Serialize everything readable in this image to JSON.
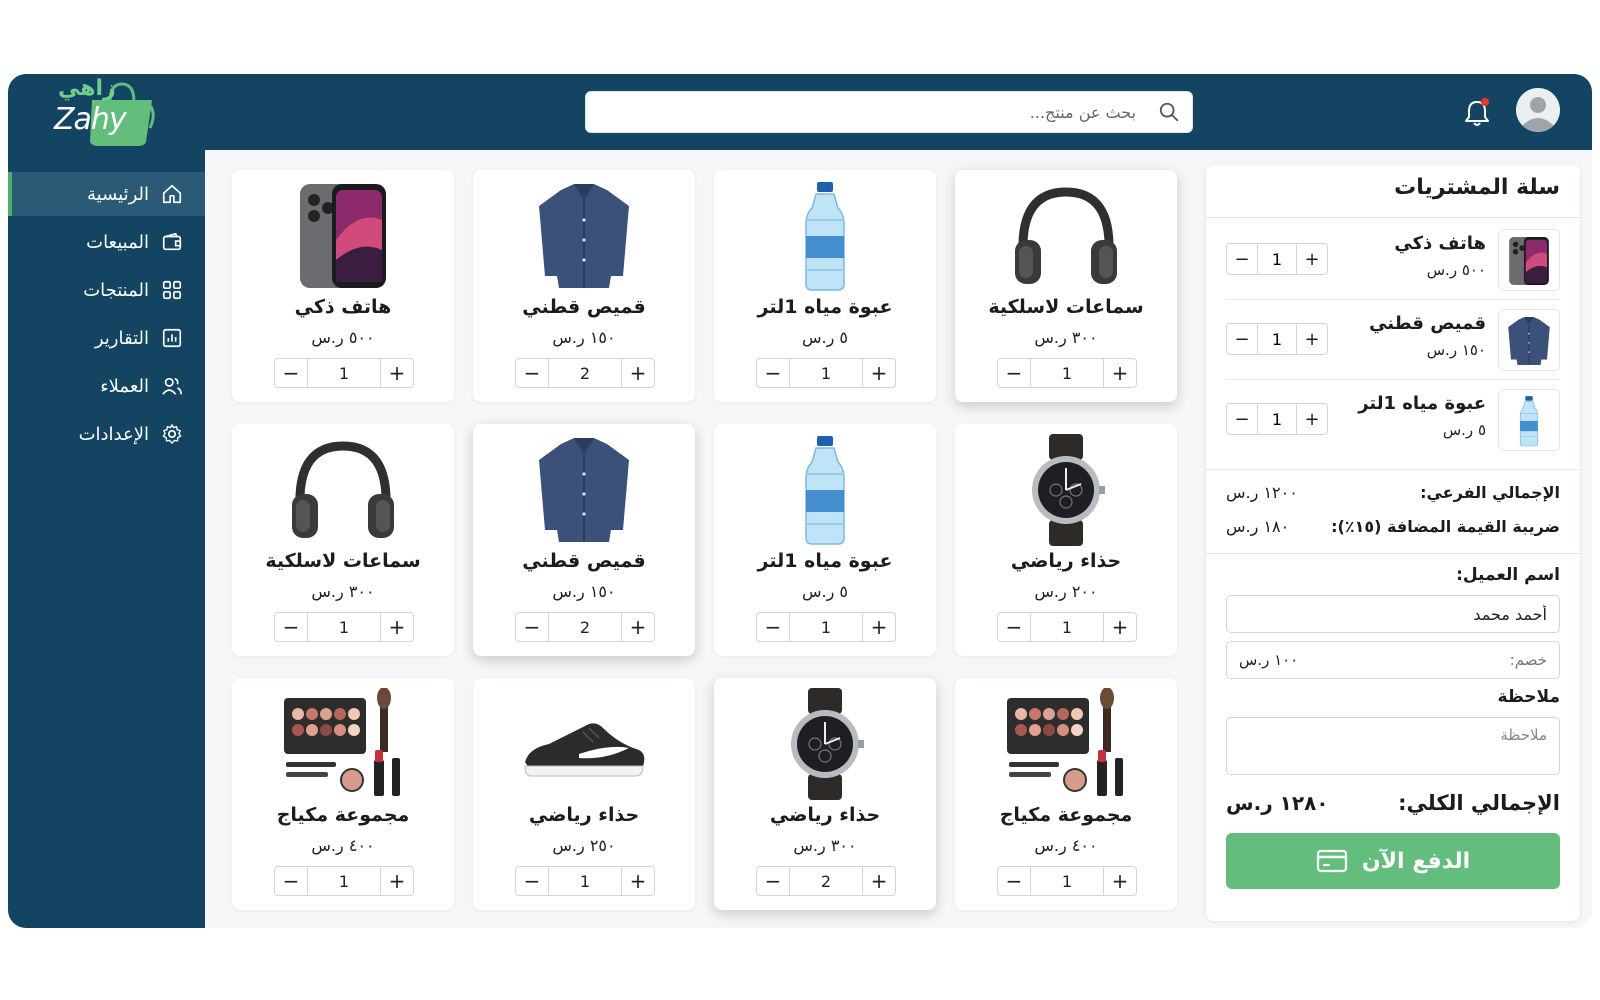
{
  "brand": {
    "logo_latin": "Zahy",
    "logo_arabic": "زاهي"
  },
  "search": {
    "placeholder": "بحث عن منتج..."
  },
  "sidebar": {
    "items": [
      {
        "label": "الرئيسية",
        "icon": "home-icon",
        "active": true
      },
      {
        "label": "المبيعات",
        "icon": "wallet-icon",
        "active": false
      },
      {
        "label": "المنتجات",
        "icon": "grid-icon",
        "active": false
      },
      {
        "label": "التقارير",
        "icon": "chart-icon",
        "active": false
      },
      {
        "label": "العملاء",
        "icon": "users-icon",
        "active": false
      },
      {
        "label": "الإعدادات",
        "icon": "gear-icon",
        "active": false
      }
    ]
  },
  "products": [
    {
      "name": "سماعات لاسلكية",
      "price": "٣٠٠ ر.س",
      "qty": "1",
      "image": "headphones",
      "elevated": true
    },
    {
      "name": "عبوة مياه 1لتر",
      "price": "٥ ر.س",
      "qty": "1",
      "image": "water-bottle",
      "elevated": false
    },
    {
      "name": "قميص قطني",
      "price": "١٥٠ ر.س",
      "qty": "2",
      "image": "shirt",
      "elevated": false
    },
    {
      "name": "هاتف ذكي",
      "price": "٥٠٠ ر.س",
      "qty": "1",
      "image": "phone",
      "elevated": false
    },
    {
      "name": "حذاء رياضي",
      "price": "٢٠٠ ر.س",
      "qty": "1",
      "image": "watch",
      "elevated": false
    },
    {
      "name": "عبوة مياه 1لتر",
      "price": "٥ ر.س",
      "qty": "1",
      "image": "water-bottle",
      "elevated": false
    },
    {
      "name": "قميص قطني",
      "price": "١٥٠ ر.س",
      "qty": "2",
      "image": "shirt",
      "elevated": true
    },
    {
      "name": "سماعات لاسلكية",
      "price": "٣٠٠ ر.س",
      "qty": "1",
      "image": "headphones",
      "elevated": false
    },
    {
      "name": "مجموعة مكياج",
      "price": "٤٠٠ ر.س",
      "qty": "1",
      "image": "makeup",
      "elevated": false
    },
    {
      "name": "حذاء رياضي",
      "price": "٣٠٠ ر.س",
      "qty": "2",
      "image": "watch",
      "elevated": true
    },
    {
      "name": "حذاء رياضي",
      "price": "٢٥٠ ر.س",
      "qty": "1",
      "image": "sneaker",
      "elevated": false
    },
    {
      "name": "مجموعة مكياج",
      "price": "٤٠٠ ر.س",
      "qty": "1",
      "image": "makeup",
      "elevated": false
    }
  ],
  "cart": {
    "title": "سلة المشتريات",
    "items": [
      {
        "name": "هاتف ذكي",
        "price": "٥٠٠ ر.س",
        "qty": "1",
        "image": "phone"
      },
      {
        "name": "قميص قطني",
        "price": "١٥٠ ر.س",
        "qty": "1",
        "image": "shirt"
      },
      {
        "name": "عبوة مياه 1لتر",
        "price": "٥ ر.س",
        "qty": "1",
        "image": "water-bottle"
      }
    ],
    "subtotal_label": "الإجمالي الفرعي:",
    "subtotal_value": "١٢٠٠ ر.س",
    "vat_label": "ضريبة القيمة المضافة (١٥٪):",
    "vat_value": "١٨٠ ر.س",
    "customer_label": "اسم العميل:",
    "customer_value": "أحمد محمد",
    "discount_label": "خصم:",
    "discount_value": "١٠٠ ر.س",
    "note_label": "ملاحظة",
    "note_placeholder": "ملاحظة",
    "total_label": "الإجمالي الكلي:",
    "total_value": "١٢٨٠ ر.س",
    "pay_label": "الدفع الآن"
  },
  "colors": {
    "primary": "#134563",
    "accent": "#63bd7c",
    "notification": "#e53935"
  }
}
